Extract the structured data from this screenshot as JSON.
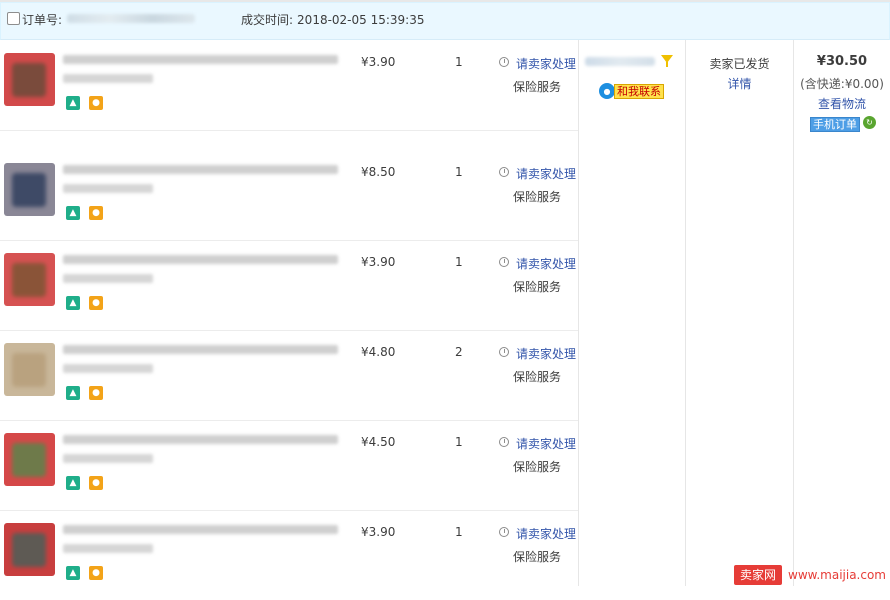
{
  "header": {
    "order_label": "订单号:",
    "deal_time_label": "成交时间:",
    "deal_time_value": "2018-02-05 15:39:35"
  },
  "items": [
    {
      "price": "¥3.90",
      "qty": "1",
      "service_link": "请卖家处理",
      "insurance": "保险服务"
    },
    {
      "price": "¥8.50",
      "qty": "1",
      "service_link": "请卖家处理",
      "insurance": "保险服务"
    },
    {
      "price": "¥3.90",
      "qty": "1",
      "service_link": "请卖家处理",
      "insurance": "保险服务"
    },
    {
      "price": "¥4.80",
      "qty": "2",
      "service_link": "请卖家处理",
      "insurance": "保险服务"
    },
    {
      "price": "¥4.50",
      "qty": "1",
      "service_link": "请卖家处理",
      "insurance": "保险服务"
    },
    {
      "price": "¥3.90",
      "qty": "1",
      "service_link": "请卖家处理",
      "insurance": "保险服务"
    }
  ],
  "seller": {
    "contact_label": "和我联系"
  },
  "status": {
    "label": "卖家已发货",
    "details_link": "详情"
  },
  "payment": {
    "total": "¥30.50",
    "shipping": "(含快递:¥0.00)",
    "logistics_link": "查看物流",
    "mobile_order_tag": "手机订单"
  },
  "watermark": {
    "brand": "卖家网",
    "url": "www.maijia.com"
  },
  "colors": {
    "header_bg": "#eaf8ff",
    "link": "#3355aa",
    "contact_bg": "#ffe24d",
    "mobile_tag": "#4d9ee6",
    "watermark": "#e63c37"
  }
}
